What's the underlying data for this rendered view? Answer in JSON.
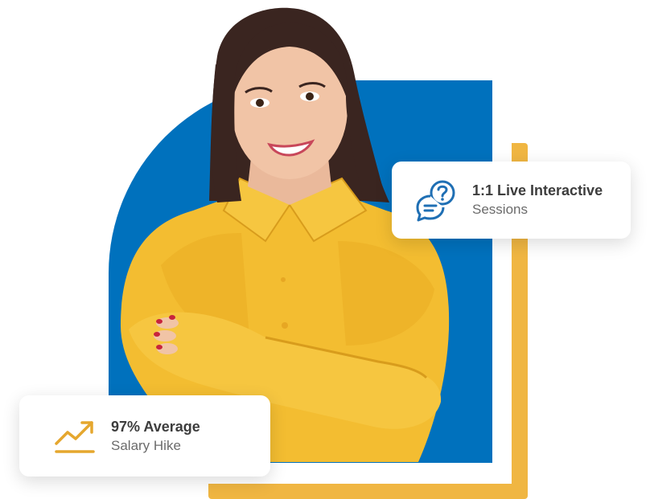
{
  "cards": {
    "sessions": {
      "icon": "chat-question-icon",
      "title": "1:1 Live Interactive",
      "subtitle": "Sessions"
    },
    "salary": {
      "icon": "trending-up-icon",
      "title": "97% Average",
      "subtitle": "Salary Hike"
    }
  },
  "colors": {
    "blue": "#0071bd",
    "yellow_frame": "#f0b642",
    "shirt": "#f3bd31",
    "icon_blue": "#1f6fb4",
    "icon_gold": "#e5a72e"
  }
}
